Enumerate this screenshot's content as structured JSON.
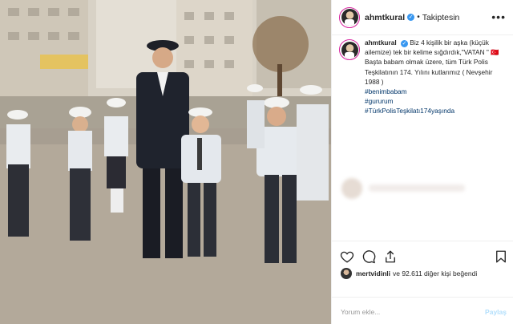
{
  "post": {
    "username": "ahmtkural",
    "follow_status": "Takiptesin",
    "more_label": "•••",
    "caption_text": "Biz 4 kişilik bir aşka (küçük ailemize) tek bir kelime sığdırdık,\"VATAN \" 🇹🇷 Başta babam olmak üzere, tüm Türk Polis Teşkilatının 174. Yılını kutlarımız ( Nevşehir 1988 )",
    "hashtags": [
      "#benimbabam",
      "#gururum",
      "#TürkPolisTeşkilatı174yaşında"
    ]
  },
  "likes": {
    "user": "mertvidinli",
    "text": "ve 92.611 diğer kişi beğendi"
  },
  "comment": {
    "placeholder": "Yorum ekle...",
    "share_label": "Paylaş"
  },
  "icons": [
    "heart-icon",
    "comment-icon",
    "share-icon",
    "bookmark-icon",
    "verified-icon"
  ],
  "colors": {
    "verified": "#3897f0",
    "hashtag": "#003569",
    "story_ring": "#d6249f",
    "share_disabled": "#b2dffc"
  }
}
